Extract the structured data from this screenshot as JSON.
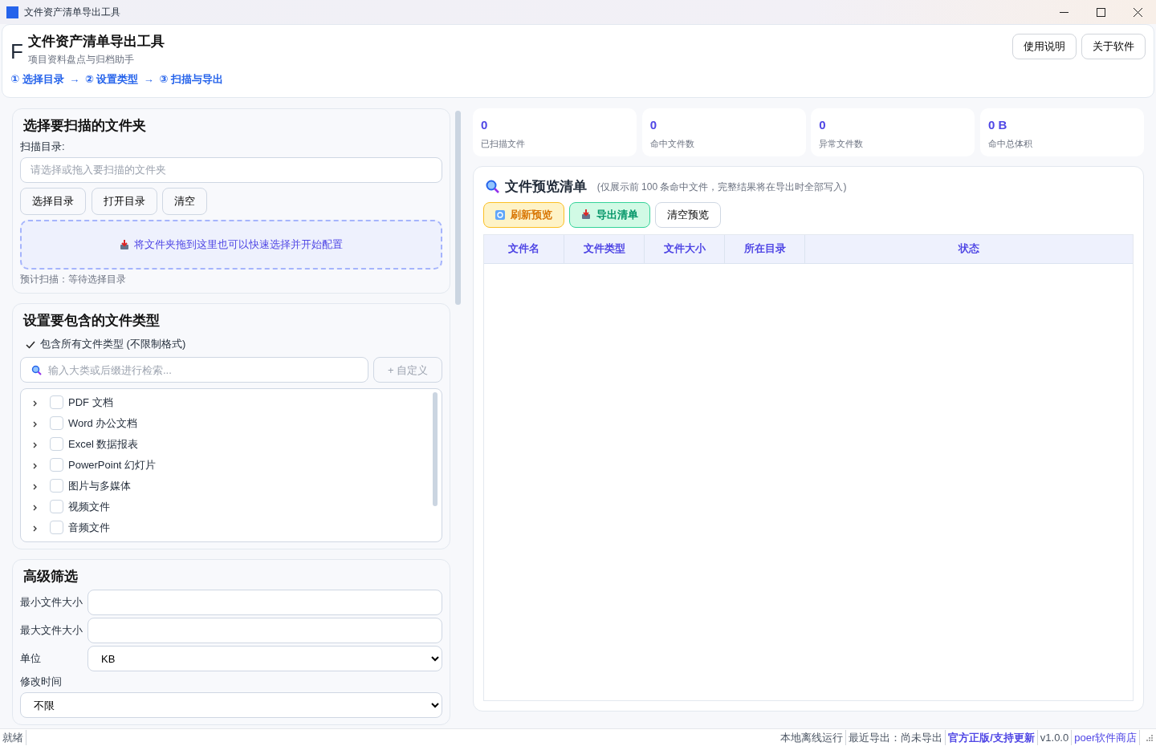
{
  "window": {
    "title": "文件资产清单导出工具"
  },
  "header": {
    "logo": "F",
    "title": "文件资产清单导出工具",
    "subtitle": "项目资料盘点与归档助手",
    "steps": [
      "① 选择目录",
      "② 设置类型",
      "③ 扫描与导出"
    ],
    "arrow": "→",
    "buttons": [
      "使用说明",
      "关于软件"
    ]
  },
  "folder_panel": {
    "title": "选择要扫描的文件夹",
    "label": "扫描目录:",
    "placeholder": "请选择或拖入要扫描的文件夹",
    "buttons": [
      "选择目录",
      "打开目录",
      "清空"
    ],
    "drop_text": "将文件夹拖到这里也可以快速选择并开始配置",
    "estimate": "预计扫描：等待选择目录"
  },
  "types_panel": {
    "title": "设置要包含的文件类型",
    "include_all": {
      "label": "包含所有文件类型 (不限制格式)",
      "checked": true
    },
    "search_placeholder": "输入大类或后缀进行检索...",
    "custom_button": "+ 自定义",
    "categories": [
      {
        "label": "PDF 文档",
        "checked": false,
        "expanded": false
      },
      {
        "label": "Word 办公文档",
        "checked": false,
        "expanded": false
      },
      {
        "label": "Excel 数据报表",
        "checked": false,
        "expanded": false
      },
      {
        "label": "PowerPoint 幻灯片",
        "checked": false,
        "expanded": false
      },
      {
        "label": "图片与多媒体",
        "checked": false,
        "expanded": false
      },
      {
        "label": "视频文件",
        "checked": false,
        "expanded": false
      },
      {
        "label": "音频文件",
        "checked": false,
        "expanded": false
      }
    ]
  },
  "filter_panel": {
    "title": "高级筛选",
    "fields": [
      {
        "kind": "input",
        "label": "最小文件大小"
      },
      {
        "kind": "input",
        "label": "最大文件大小"
      },
      {
        "kind": "select",
        "label": "单位",
        "value": "KB"
      },
      {
        "kind": "select_below",
        "label": "修改时间",
        "value": "不限"
      }
    ]
  },
  "stats": [
    {
      "value": "0",
      "label": "已扫描文件"
    },
    {
      "value": "0",
      "label": "命中文件数"
    },
    {
      "value": "0",
      "label": "异常文件数"
    },
    {
      "value": "0 B",
      "label": "命中总体积"
    }
  ],
  "preview": {
    "title": "文件预览清单",
    "note": "(仅展示前 100 条命中文件，完整结果将在导出时全部写入)",
    "buttons": [
      {
        "kind": "refresh",
        "label": "刷新预览"
      },
      {
        "kind": "export",
        "label": "导出清单"
      },
      {
        "kind": "plain",
        "label": "清空预览"
      }
    ],
    "columns": [
      "文件名",
      "文件类型",
      "文件大小",
      "所在目录",
      "状态"
    ]
  },
  "status_bar": {
    "left": "就绪",
    "items": [
      {
        "kind": "text",
        "text": "本地离线运行"
      },
      {
        "kind": "text",
        "text": "最近导出：尚未导出"
      },
      {
        "kind": "link",
        "text": "官方正版/支持更新"
      },
      {
        "kind": "text",
        "text": "v1.0.0"
      },
      {
        "kind": "link",
        "text": "poer软件商店"
      }
    ]
  }
}
